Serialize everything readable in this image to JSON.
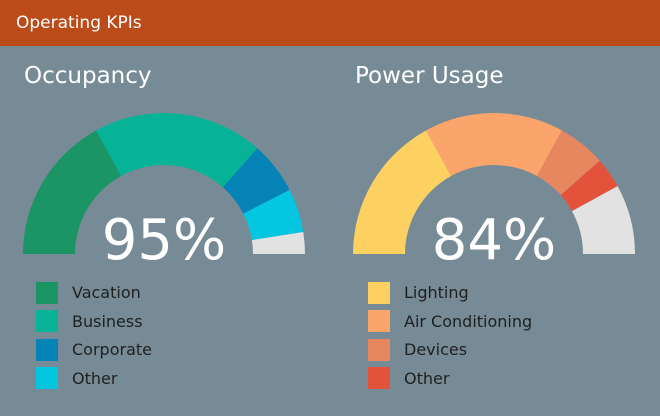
{
  "header": {
    "title": "Operating KPIs"
  },
  "chart_data": [
    {
      "type": "gauge",
      "title": "Occupancy",
      "value_label": "95%",
      "total_percent": 95,
      "series": [
        {
          "name": "Vacation",
          "value": 34,
          "color": "#1b9466"
        },
        {
          "name": "Business",
          "value": 39,
          "color": "#06b397"
        },
        {
          "name": "Corporate",
          "value": 12,
          "color": "#0684b7"
        },
        {
          "name": "Other",
          "value": 10,
          "color": "#05c6e0"
        }
      ],
      "remainder_color": "#e2e2e2"
    },
    {
      "type": "gauge",
      "title": "Power Usage",
      "value_label": "84%",
      "total_percent": 84,
      "series": [
        {
          "name": "Lighting",
          "value": 34,
          "color": "#fdd062"
        },
        {
          "name": "Air Conditioning",
          "value": 32,
          "color": "#fba46b"
        },
        {
          "name": "Devices",
          "value": 11,
          "color": "#e68760"
        },
        {
          "name": "Other",
          "value": 7,
          "color": "#e3523a"
        }
      ],
      "remainder_color": "#e2e2e2"
    }
  ]
}
